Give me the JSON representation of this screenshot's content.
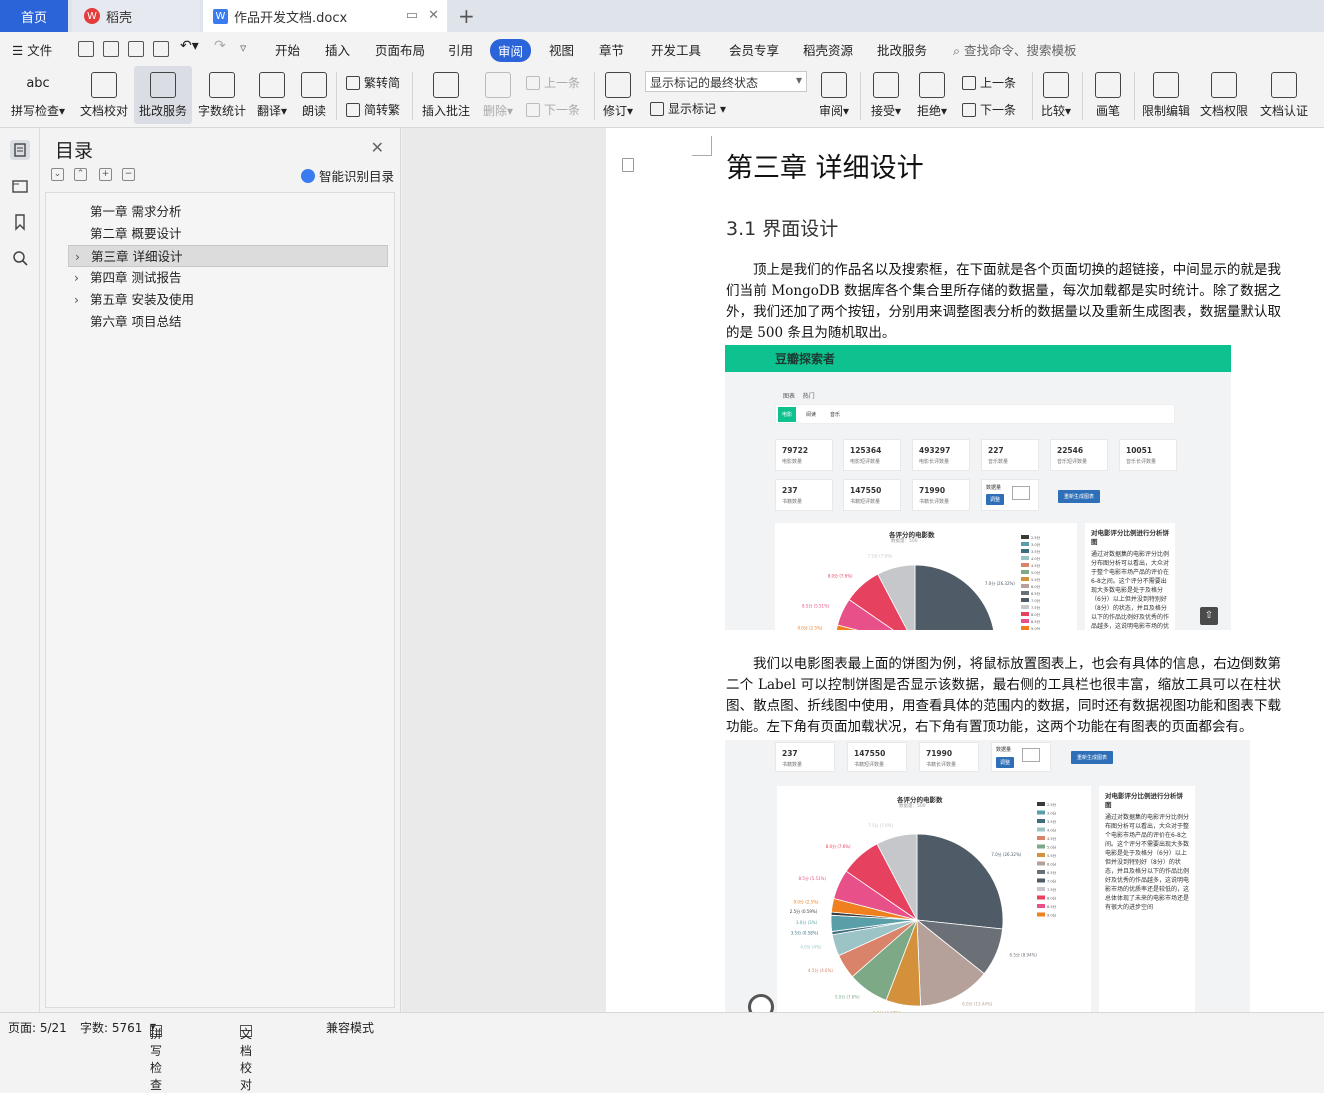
{
  "titlebar": {
    "tab_home": "首页",
    "tab_daoke": "稻壳",
    "tab_doc": "作品开发文档.docx"
  },
  "menubar": {
    "file": "文件",
    "items": [
      "开始",
      "插入",
      "页面布局",
      "引用",
      "审阅",
      "视图",
      "章节",
      "开发工具",
      "会员专享",
      "稻壳资源",
      "批改服务"
    ],
    "active": "审阅",
    "search": "查找命令、搜索模板"
  },
  "ribbon": {
    "spell": "拼写检查",
    "doccheck": "文档校对",
    "correct": "批改服务",
    "wordcount": "字数统计",
    "translate": "翻译",
    "read": "朗读",
    "t2s": "繁转简",
    "s2t": "简转繁",
    "insert_comment": "插入批注",
    "delete": "删除",
    "prev": "上一条",
    "next": "下一条",
    "revise": "修订",
    "markup_state": "显示标记的最终状态",
    "show_markup": "显示标记",
    "review": "审阅",
    "accept": "接受",
    "reject": "拒绝",
    "prev2": "上一条",
    "next2": "下一条",
    "compare": "比较",
    "pen": "画笔",
    "restrict": "限制编辑",
    "perm": "文档权限",
    "cert": "文档认证"
  },
  "toc": {
    "title": "目录",
    "smart": "智能识别目录",
    "items": [
      {
        "label": "第一章 需求分析"
      },
      {
        "label": "第二章 概要设计"
      },
      {
        "label": "第三章 详细设计"
      },
      {
        "label": "第四章 测试报告"
      },
      {
        "label": "第五章 安装及使用"
      },
      {
        "label": "第六章 项目总结"
      }
    ]
  },
  "doc": {
    "h1": "第三章 详细设计",
    "h2": "3.1  界面设计",
    "para1": "顶上是我们的作品名以及搜索框，在下面就是各个页面切换的超链接，中间显示的就是我们当前 MongoDB 数据库各个集合里所存储的数据量，每次加载都是实时统计。除了数据之外，我们还加了两个按钮，分别用来调整图表分析的数据量以及重新生成图表，数据量默认取的是 500 条且为随机取出。",
    "para2": "我们以电影图表最上面的饼图为例，将鼠标放置图表上，也会有具体的信息，右边倒数第二个 Label 可以控制饼图是否显示该数据，最右侧的工具栏也很丰富，缩放工具可以在柱状图、散点图、折线图中使用，用查看具体的范围内的数据，同时还有数据视图功能和图表下载功能。左下角有页面加载状况，右下角有置顶功能，这两个功能在有图表的页面都会有。"
  },
  "shot1": {
    "app_title": "豆瓣探索者",
    "nav": [
      "图表",
      "热门"
    ],
    "subtabs": [
      "电影",
      "阅读",
      "音乐"
    ],
    "cards": [
      {
        "num": "79722",
        "lbl": "电影数量"
      },
      {
        "num": "125364",
        "lbl": "电影短评数量"
      },
      {
        "num": "493297",
        "lbl": "电影长评数量"
      },
      {
        "num": "227",
        "lbl": "音乐数量"
      },
      {
        "num": "22546",
        "lbl": "音乐短评数量"
      },
      {
        "num": "10051",
        "lbl": "音乐长评数量"
      },
      {
        "num": "237",
        "lbl": "书籍数量"
      },
      {
        "num": "147550",
        "lbl": "书籍短评数量"
      },
      {
        "num": "71990",
        "lbl": "书籍长评数量"
      }
    ],
    "data_amount_label": "数据量",
    "adjust": "调整",
    "regenerate": "重新生成图表",
    "pie_title": "各评分的电影数",
    "pie_subtitle": "数据量：500",
    "side_title": "对电影评分比例进行分析饼图",
    "side_text": "通过对数据集的电影评分比例分布图分析可以看出，大众对于整个电影市场产品的评价在6-8之间。这个评分不需要出现大多数电影是处于及格分（6分）以上但并没到特别好（8分）的状态，并且及格分以下的作品比例好及优秀的作品越多，这说明电影市场的优质率还是较低的，这总体体现了未来的电影市场还是有很大的进步空间"
  },
  "pie": {
    "slices": [
      {
        "label": "7.0分",
        "value": 26.32,
        "color": "#4f5b66"
      },
      {
        "label": "6.5分",
        "value": 8.94,
        "color": "#6b7077"
      },
      {
        "label": "6.0分",
        "value": 13.44,
        "color": "#b5a199"
      },
      {
        "label": "5.5分",
        "value": 6.43,
        "color": "#d2913a"
      },
      {
        "label": "5.0分",
        "value": 7.6,
        "color": "#7ea987"
      },
      {
        "label": "4.5分",
        "value": 4.6,
        "color": "#d9836b"
      },
      {
        "label": "4.0分",
        "value": 4.0,
        "color": "#9cc3c6"
      },
      {
        "label": "3.5分",
        "value": 0.58,
        "color": "#3f6d7d"
      },
      {
        "label": "3.0分",
        "value": 3.0,
        "color": "#5a9fa8"
      },
      {
        "label": "2.5分",
        "value": 0.59,
        "color": "#3a3a3a"
      },
      {
        "label": "9.0分",
        "value": 2.5,
        "color": "#f07f1f"
      },
      {
        "label": "8.5分",
        "value": 5.51,
        "color": "#e8508a"
      },
      {
        "label": "8.0分",
        "value": 7.6,
        "color": "#e6415f"
      },
      {
        "label": "7.5分",
        "value": 7.6,
        "color": "#c5c7cb"
      }
    ],
    "legend": [
      "2.5分",
      "3.0分",
      "3.5分",
      "4.0分",
      "4.5分",
      "5.0分",
      "5.5分",
      "6.0分",
      "6.5分",
      "7.0分",
      "7.5分",
      "8.0分",
      "8.5分",
      "9.0分"
    ]
  },
  "status": {
    "page": "页面: 5/21",
    "words": "字数: 5761",
    "spell": "拼写检查",
    "doccheck": "文档校对",
    "compat": "兼容模式"
  }
}
